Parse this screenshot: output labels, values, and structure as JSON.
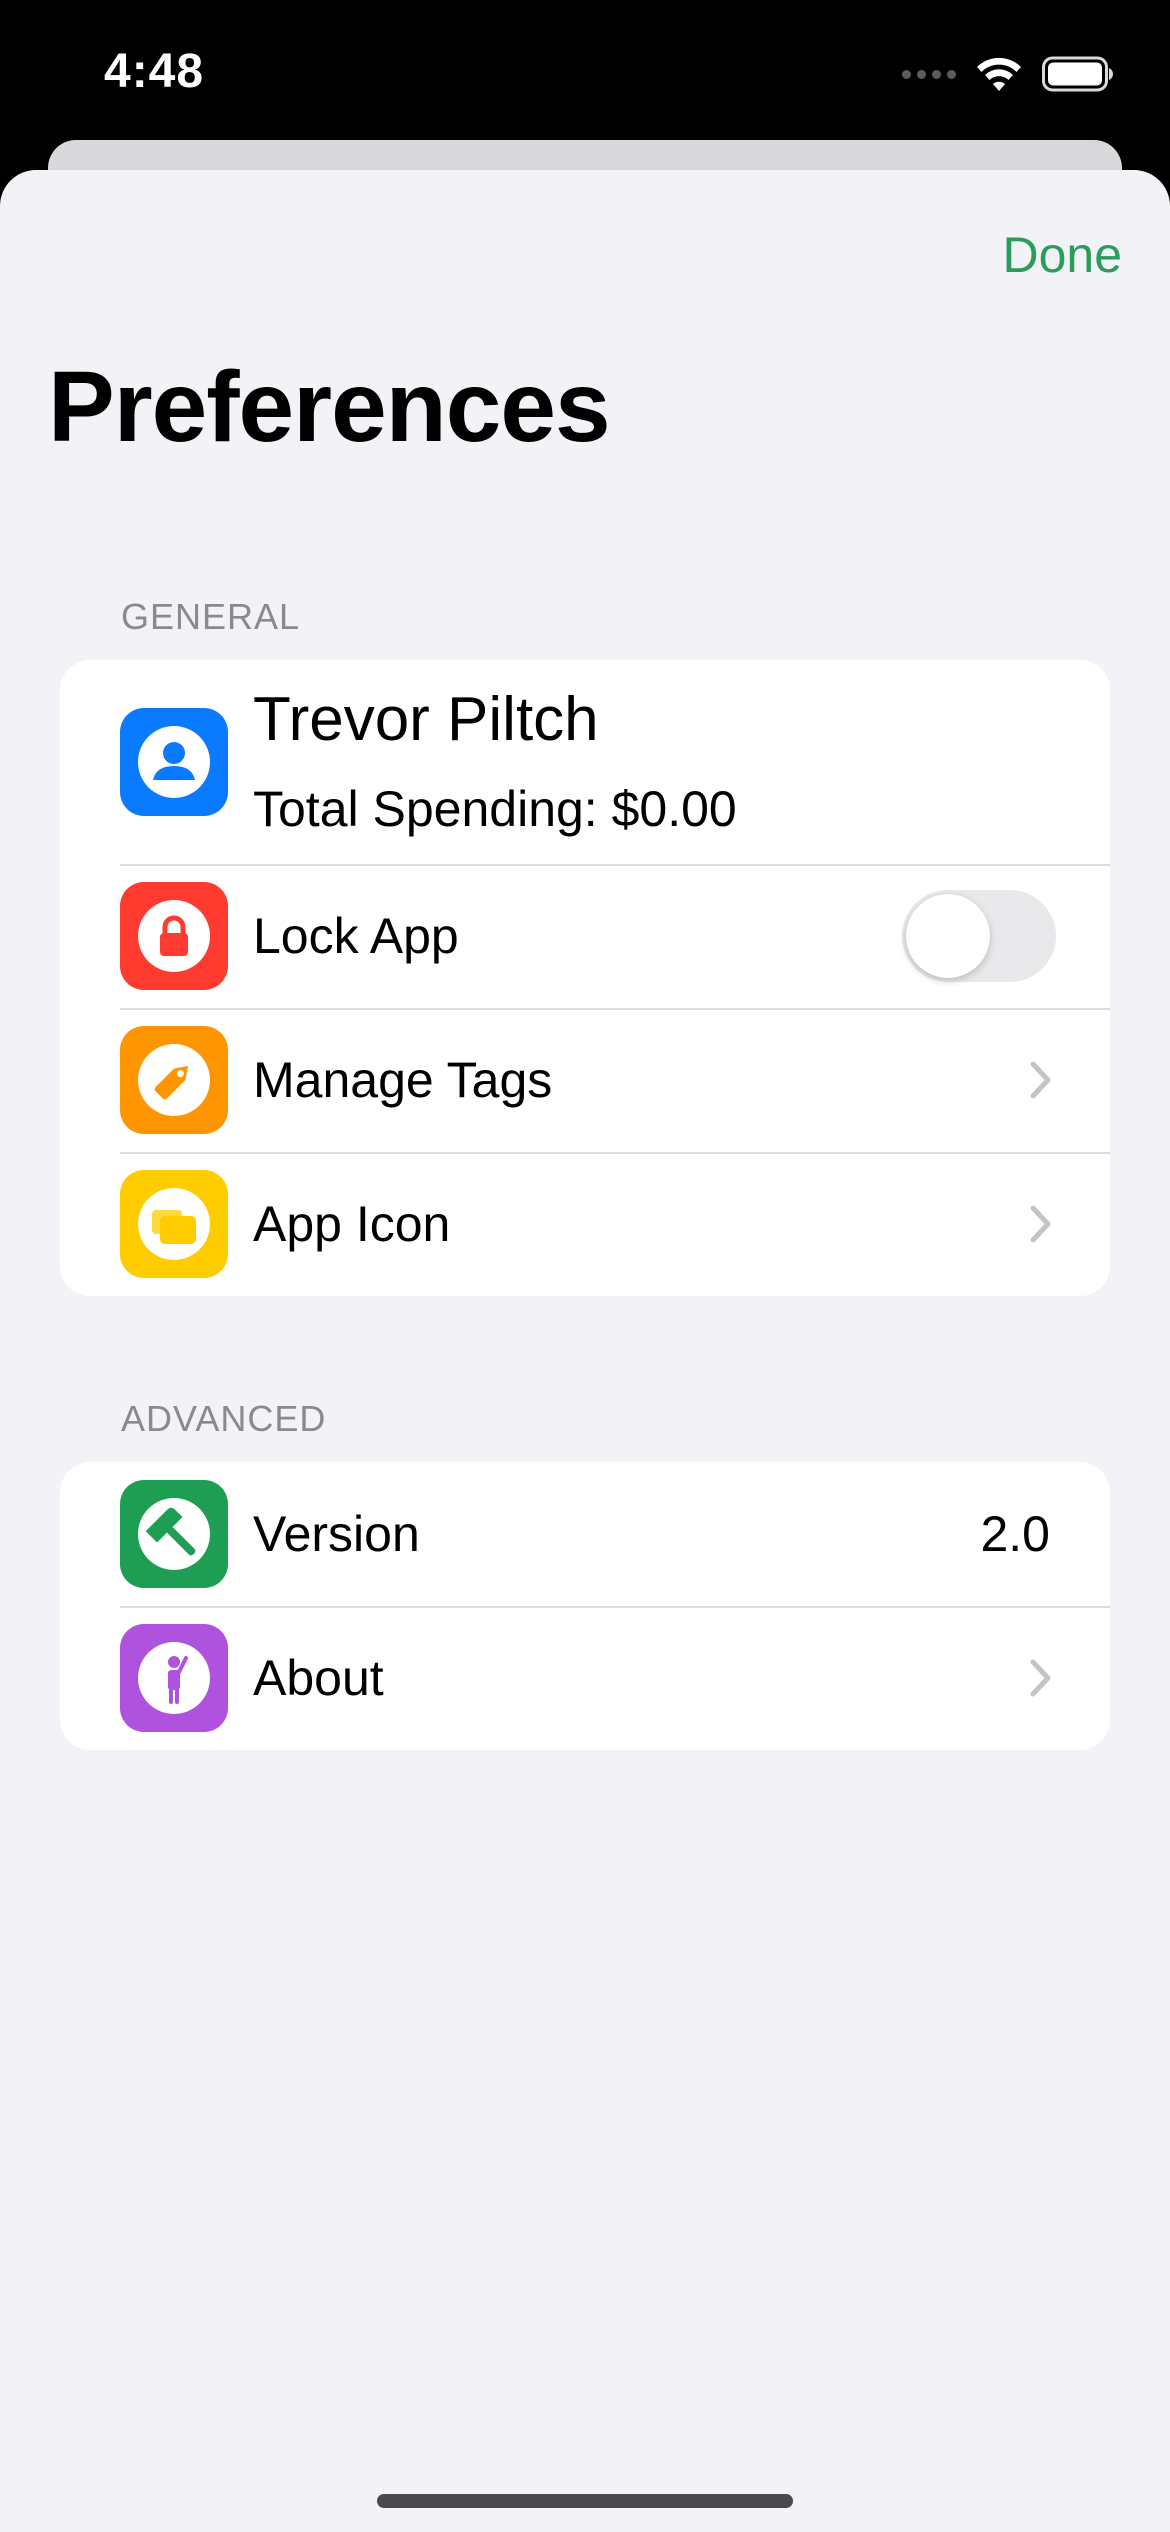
{
  "status_bar": {
    "time": "4:48",
    "icons": [
      "signal-dots-icon",
      "wifi-icon",
      "battery-icon"
    ]
  },
  "header": {
    "done_label": "Done",
    "title": "Preferences"
  },
  "colors": {
    "accent": "#2a9d5b",
    "profile_icon": "#0a7aff",
    "lock_icon": "#ff3b30",
    "tags_icon": "#ff9500",
    "app_icon_icon": "#ffcc00",
    "version_icon": "#1e9e52",
    "about_icon": "#af52de"
  },
  "general": {
    "header": "GENERAL",
    "profile": {
      "name": "Trevor Piltch",
      "subtitle": "Total Spending: $0.00",
      "icon": "person-icon"
    },
    "lock_app": {
      "label": "Lock App",
      "icon": "lock-icon",
      "toggle_on": false
    },
    "manage_tags": {
      "label": "Manage Tags",
      "icon": "tag-icon"
    },
    "app_icon": {
      "label": "App Icon",
      "icon": "app-icon-icon"
    }
  },
  "advanced": {
    "header": "ADVANCED",
    "version": {
      "label": "Version",
      "value": "2.0",
      "icon": "hammer-icon"
    },
    "about": {
      "label": "About",
      "icon": "person-raised-hand-icon"
    }
  }
}
